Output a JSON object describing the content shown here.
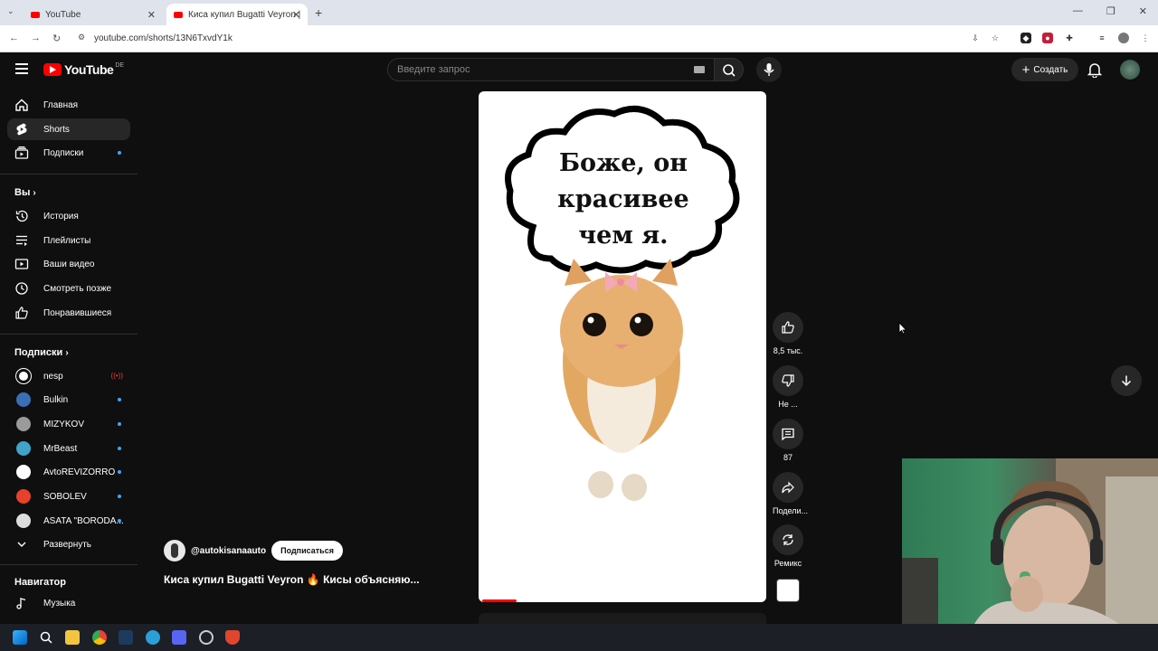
{
  "browser": {
    "tabs": [
      {
        "title": "YouTube",
        "close": "✕"
      },
      {
        "title": "Киса купил Bugatti Veyron |",
        "close": "✕"
      }
    ],
    "new_tab": "+",
    "url": "youtube.com/shorts/13N6TxvdY1k",
    "window_controls": [
      "—",
      "❐",
      "✕"
    ]
  },
  "header": {
    "logo": "YouTube",
    "country": "DE",
    "search_placeholder": "Введите запрос",
    "create_label": "Создать"
  },
  "sidebar": {
    "main": [
      {
        "label": "Главная",
        "icon": "home-icon"
      },
      {
        "label": "Shorts",
        "icon": "shorts-icon",
        "active": true
      },
      {
        "label": "Подписки",
        "icon": "subscriptions-icon",
        "dot": true
      }
    ],
    "you_heading": "Вы",
    "you": [
      {
        "label": "История",
        "icon": "history-icon"
      },
      {
        "label": "Плейлисты",
        "icon": "playlists-icon"
      },
      {
        "label": "Ваши видео",
        "icon": "your-videos-icon"
      },
      {
        "label": "Смотреть позже",
        "icon": "watch-later-icon"
      },
      {
        "label": "Понравившиеся",
        "icon": "liked-icon"
      }
    ],
    "subs_heading": "Подписки",
    "subs": [
      {
        "label": "nesp",
        "color": "#ffffff",
        "live": true
      },
      {
        "label": "Bulkin",
        "color": "#3a6fb5",
        "dot": true
      },
      {
        "label": "MIZYKOV",
        "color": "#9a9a9a",
        "dot": true
      },
      {
        "label": "MrBeast",
        "color": "#3fa4c9",
        "dot": true
      },
      {
        "label": "AvtoREVIZORRO",
        "color": "#ffffff",
        "dot": true
      },
      {
        "label": "SOBOLEV",
        "color": "#e8412a",
        "dot": true
      },
      {
        "label": "ASATA \"BORODA...",
        "color": "#dddddd",
        "dot": true
      }
    ],
    "expand_label": "Развернуть",
    "nav_heading": "Навигатор",
    "nav": [
      {
        "label": "Музыка",
        "icon": "music-icon"
      }
    ]
  },
  "short": {
    "bubble_text": [
      "Боже, он",
      "красивее",
      "чем я."
    ],
    "channel": "@autokisanaauto",
    "subscribe_label": "Подписаться",
    "title": "Киса купил  Bugatti Veyron 🔥 Кисы объясняю...",
    "progress": 0.12,
    "actions": [
      {
        "name": "like",
        "label": "8,5 тыс."
      },
      {
        "name": "dislike",
        "label": "Не ..."
      },
      {
        "name": "comments",
        "label": "87"
      },
      {
        "name": "share",
        "label": "Подели..."
      },
      {
        "name": "remix",
        "label": "Ремикс"
      }
    ]
  },
  "colors": {
    "bg": "#0f0f0f",
    "accent": "#ff0000",
    "chip": "#272727",
    "link": "#3ea6ff"
  }
}
